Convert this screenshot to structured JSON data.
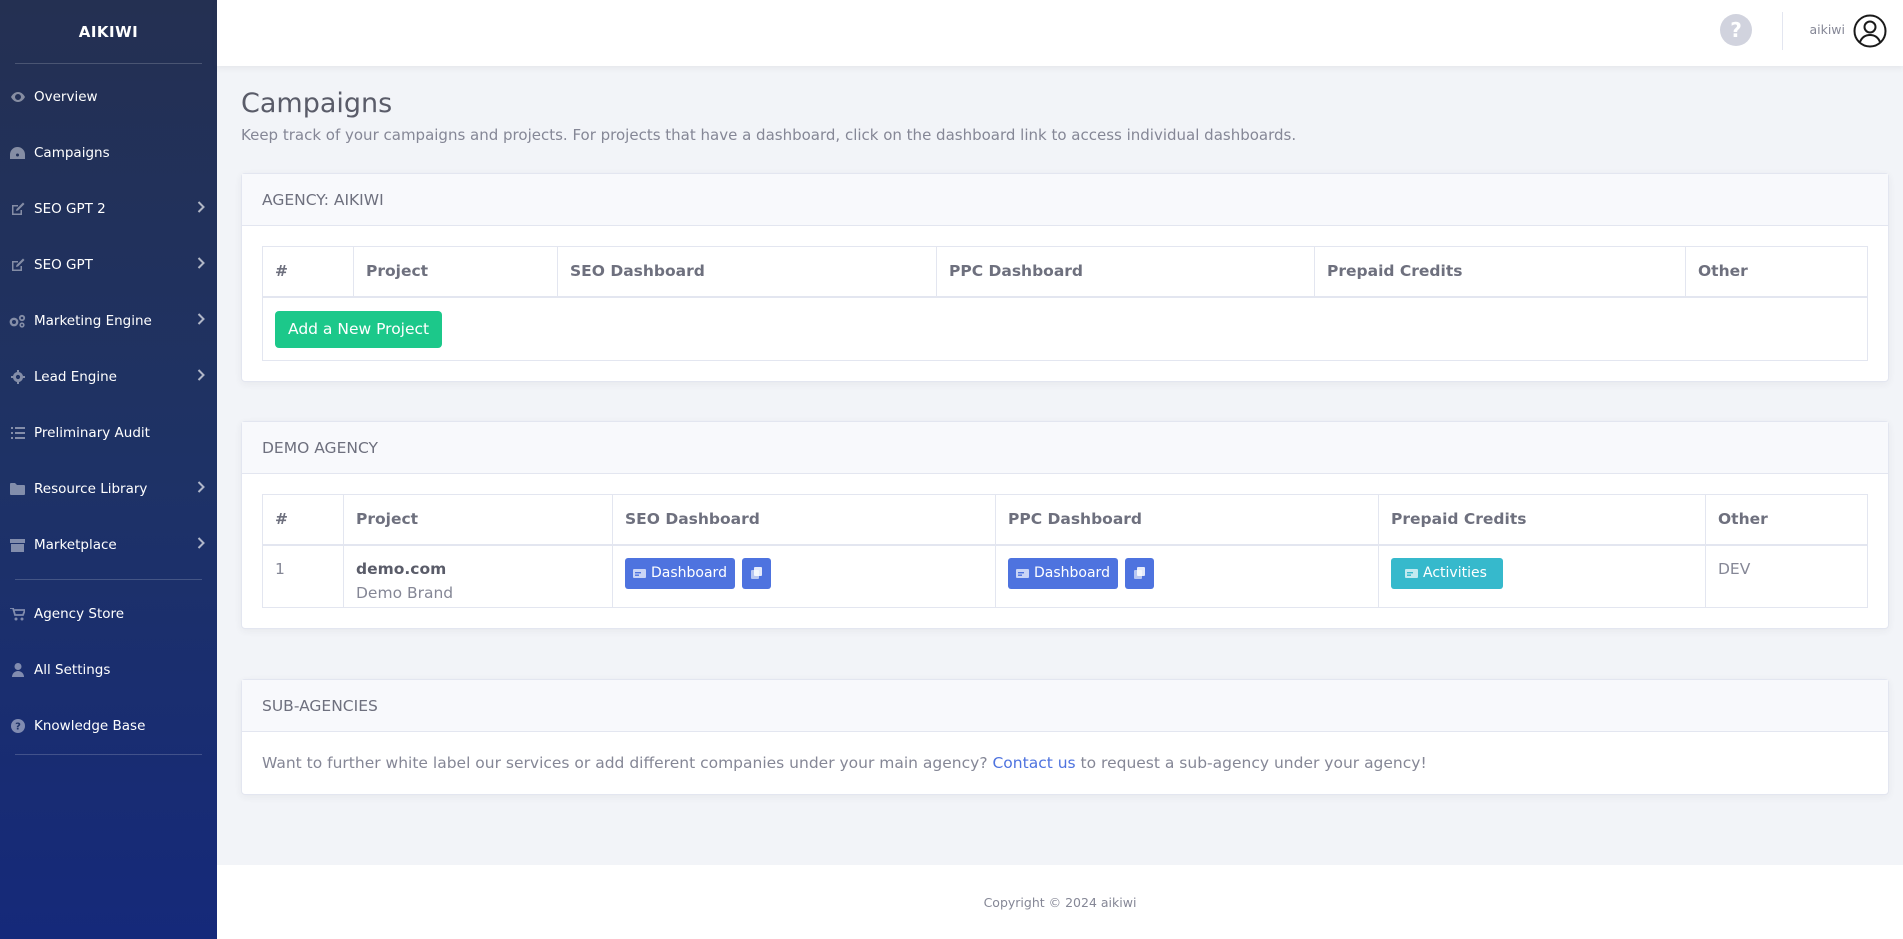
{
  "sidebar": {
    "brand": "AIKIWI",
    "items": [
      {
        "label": "Overview",
        "icon": "eye-icon",
        "has_submenu": false
      },
      {
        "label": "Campaigns",
        "icon": "dashboard-icon",
        "has_submenu": false
      },
      {
        "label": "SEO GPT 2",
        "icon": "edit-icon",
        "has_submenu": true
      },
      {
        "label": "SEO GPT",
        "icon": "edit-icon",
        "has_submenu": true
      },
      {
        "label": "Marketing Engine",
        "icon": "cogs-icon",
        "has_submenu": true
      },
      {
        "label": "Lead Engine",
        "icon": "gear-icon",
        "has_submenu": true
      },
      {
        "label": "Preliminary Audit",
        "icon": "list-icon",
        "has_submenu": false
      },
      {
        "label": "Resource Library",
        "icon": "folder-icon",
        "has_submenu": true
      },
      {
        "label": "Marketplace",
        "icon": "store-icon",
        "has_submenu": true
      }
    ],
    "items2": [
      {
        "label": "Agency Store",
        "icon": "cart-icon"
      },
      {
        "label": "All Settings",
        "icon": "user-icon"
      },
      {
        "label": "Knowledge Base",
        "icon": "question-icon"
      }
    ]
  },
  "topbar": {
    "help_glyph": "?",
    "username": "aikiwi"
  },
  "page": {
    "title": "Campaigns",
    "description": "Keep track of your campaigns and projects. For projects that have a dashboard, click on the dashboard link to access individual dashboards."
  },
  "agency_card": {
    "header": "AGENCY: AIKIWI",
    "columns": [
      "#",
      "Project",
      "SEO Dashboard",
      "PPC Dashboard",
      "Prepaid Credits",
      "Other"
    ],
    "add_button": "Add a New Project"
  },
  "demo_card": {
    "header": "DEMO AGENCY",
    "columns": [
      "#",
      "Project",
      "SEO Dashboard",
      "PPC Dashboard",
      "Prepaid Credits",
      "Other"
    ],
    "row": {
      "num": "1",
      "project": "demo.com",
      "brand": "Demo Brand",
      "seo_button": "Dashboard",
      "ppc_button": "Dashboard",
      "credits_button": "Activities",
      "other": "DEV"
    }
  },
  "sub_card": {
    "header": "SUB-AGENCIES",
    "text_before": "Want to further white label our services or add different companies under your main agency? ",
    "link": "Contact us",
    "text_after": " to request a sub-agency under your agency!"
  },
  "footer": {
    "copyright": "Copyright © 2024 aikiwi"
  },
  "colors": {
    "sidebar_top": "#243052",
    "sidebar_bottom": "#15297a",
    "success": "#1cc88a",
    "primary": "#4e73df",
    "info": "#36b9cc"
  }
}
